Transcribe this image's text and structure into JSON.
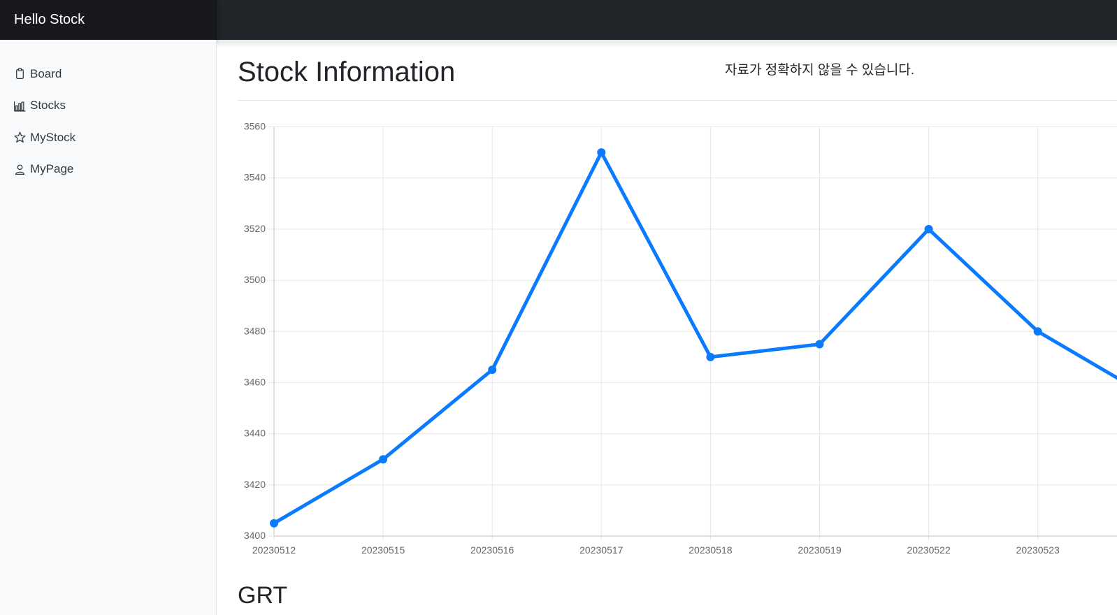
{
  "app": {
    "brand": "Hello Stock"
  },
  "sidebar": {
    "items": [
      {
        "label": "Board",
        "icon": "clipboard-icon"
      },
      {
        "label": "Stocks",
        "icon": "bar-chart-icon"
      },
      {
        "label": "MyStock",
        "icon": "star-icon"
      },
      {
        "label": "MyPage",
        "icon": "person-icon"
      }
    ]
  },
  "main": {
    "title": "Stock Information",
    "notice": "자료가 정확하지 않을 수 있습니다.",
    "section_title": "GRT"
  },
  "colors": {
    "line": "#0a7bff",
    "topbar": "#212529",
    "sidebar_bg": "#f8f9fa"
  },
  "chart_data": {
    "type": "line",
    "categories": [
      "20230512",
      "20230515",
      "20230516",
      "20230517",
      "20230518",
      "20230519",
      "20230522",
      "20230523"
    ],
    "series": [
      {
        "values": [
          3405,
          3430,
          3465,
          3550,
          3470,
          3475,
          3520,
          3480,
          3455
        ]
      }
    ],
    "yticks": [
      3400,
      3420,
      3440,
      3460,
      3480,
      3500,
      3520,
      3540,
      3560
    ],
    "ylim": [
      3400,
      3560
    ],
    "grid": true,
    "title": "",
    "xlabel": "",
    "ylabel": ""
  }
}
